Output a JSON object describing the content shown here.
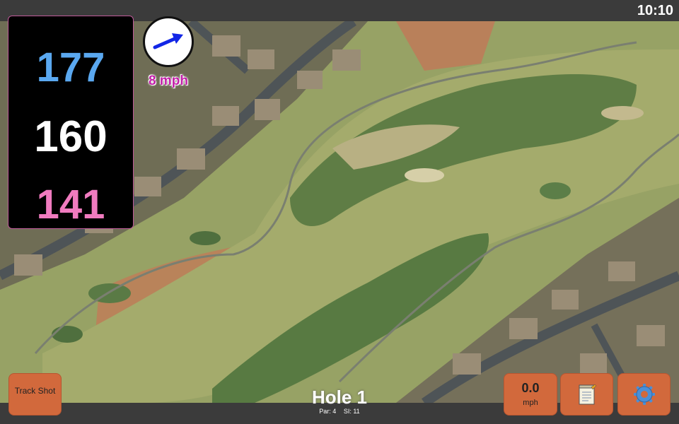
{
  "status": {
    "time": "10:10"
  },
  "distances": {
    "back": "177",
    "middle": "160",
    "front": "141",
    "colors": {
      "back": "#5aa8f0",
      "middle": "#ffffff",
      "front": "#f07bbf"
    }
  },
  "wind": {
    "speed": "8 mph",
    "arrow_icon": "wind-direction-arrow-icon",
    "arrow_color": "#1226e6",
    "label_color": "#c21fa8"
  },
  "hole": {
    "title": "Hole 1",
    "par": "Par: 4",
    "si": "SI: 11"
  },
  "buttons": {
    "track_shot": "Track Shot",
    "speed_value": "0.0",
    "speed_unit": "mph",
    "notes_icon": "notepad-icon",
    "settings_icon": "gear-icon",
    "accent": "#d2693c"
  }
}
